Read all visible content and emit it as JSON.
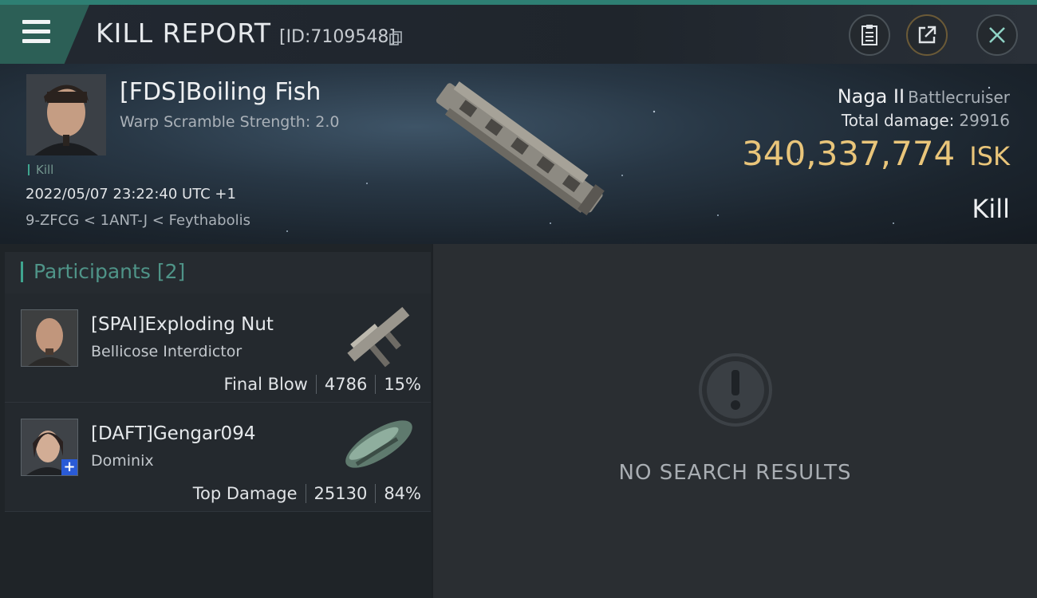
{
  "header": {
    "title": "KILL REPORT",
    "report_id": "[ID:7109548]"
  },
  "victim": {
    "name": "[FDS]Boiling Fish",
    "warp_scramble": "Warp Scramble Strength: 2.0",
    "kill_tag": "Kill",
    "datetime": "2022/05/07 23:22:40 UTC +1",
    "location": "9-ZFCG < 1ANT-J < Feythabolis",
    "ship_name": "Naga II",
    "ship_class": "Battlecruiser",
    "total_damage_label": "Total damage:",
    "total_damage": "29916",
    "isk_value": "340,337,774",
    "isk_label": "ISK",
    "result": "Kill"
  },
  "participants": {
    "label": "Participants",
    "count": "[2]",
    "rows": [
      {
        "name": "[SPAI]Exploding Nut",
        "ship": "Bellicose Interdictor",
        "role": "Final Blow",
        "damage": "4786",
        "percent": "15%"
      },
      {
        "name": "[DAFT]Gengar094",
        "ship": "Dominix",
        "role": "Top Damage",
        "damage": "25130",
        "percent": "84%"
      }
    ]
  },
  "detail_panel": {
    "empty_text": "NO SEARCH RESULTS"
  },
  "colors": {
    "accent": "#2e7f73",
    "isk": "#e9c57a",
    "participants_label": "#4f9488"
  },
  "icons": [
    "menu-icon",
    "copy-icon",
    "clipboard-icon",
    "share-icon",
    "close-icon",
    "alert-icon"
  ]
}
